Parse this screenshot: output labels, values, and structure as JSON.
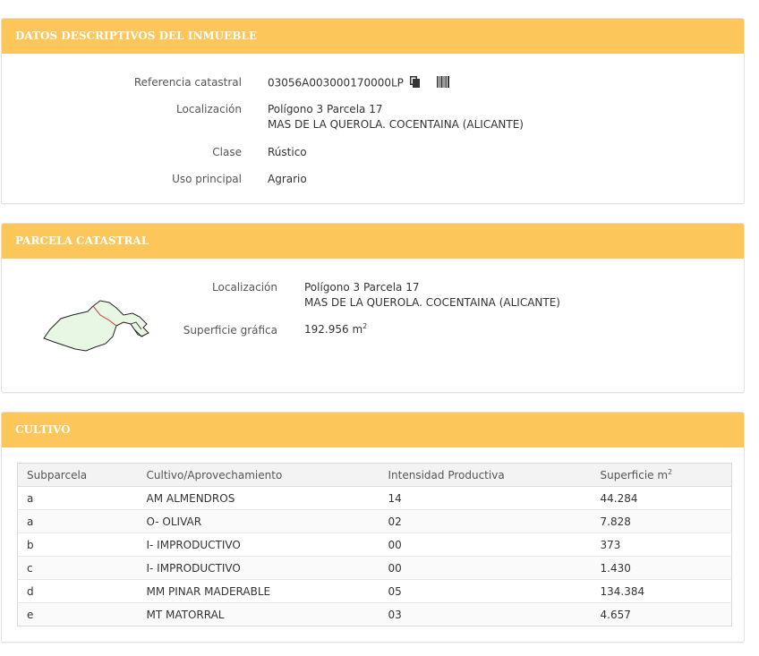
{
  "datos": {
    "heading": "DATOS DESCRIPTIVOS DEL INMUEBLE",
    "ref_label": "Referencia catastral",
    "ref_value": "03056A003000170000LP",
    "loc_label": "Localización",
    "loc_line1": "Polígono 3 Parcela 17",
    "loc_line2": "MAS DE LA QUEROLA. COCENTAINA (ALICANTE)",
    "clase_label": "Clase",
    "clase_value": "Rústico",
    "uso_label": "Uso principal",
    "uso_value": "Agrario",
    "icons": [
      "copy-icon",
      "barcode-icon"
    ]
  },
  "parcela": {
    "heading": "PARCELA CATASTRAL",
    "loc_label": "Localización",
    "loc_line1": "Polígono 3 Parcela 17",
    "loc_line2": "MAS DE LA QUEROLA. COCENTAINA (ALICANTE)",
    "sup_label": "Superficie gráfica",
    "sup_value": "192.956 m",
    "sup_unit_exp": "2",
    "map_fill": "#e8f7e4",
    "map_outline": "#222222",
    "map_subdivision": "#cc3333"
  },
  "cultivo": {
    "heading": "CULTIVO",
    "columns": [
      "Subparcela",
      "Cultivo/Aprovechamiento",
      "Intensidad Productiva",
      "Superficie m"
    ],
    "col_unit_exp": "2",
    "rows": [
      [
        "a",
        "AM ALMENDROS",
        "14",
        "44.284"
      ],
      [
        "a",
        "O- OLIVAR",
        "02",
        "7.828"
      ],
      [
        "b",
        "I- IMPRODUCTIVO",
        "00",
        "373"
      ],
      [
        "c",
        "I- IMPRODUCTIVO",
        "00",
        "1.430"
      ],
      [
        "d",
        "MM PINAR MADERABLE",
        "05",
        "134.384"
      ],
      [
        "e",
        "MT MATORRAL",
        "03",
        "4.657"
      ]
    ]
  },
  "colors": {
    "heading_bg": "#fcc65b",
    "heading_text": "#ffffff",
    "border": "#e2e2e2"
  }
}
